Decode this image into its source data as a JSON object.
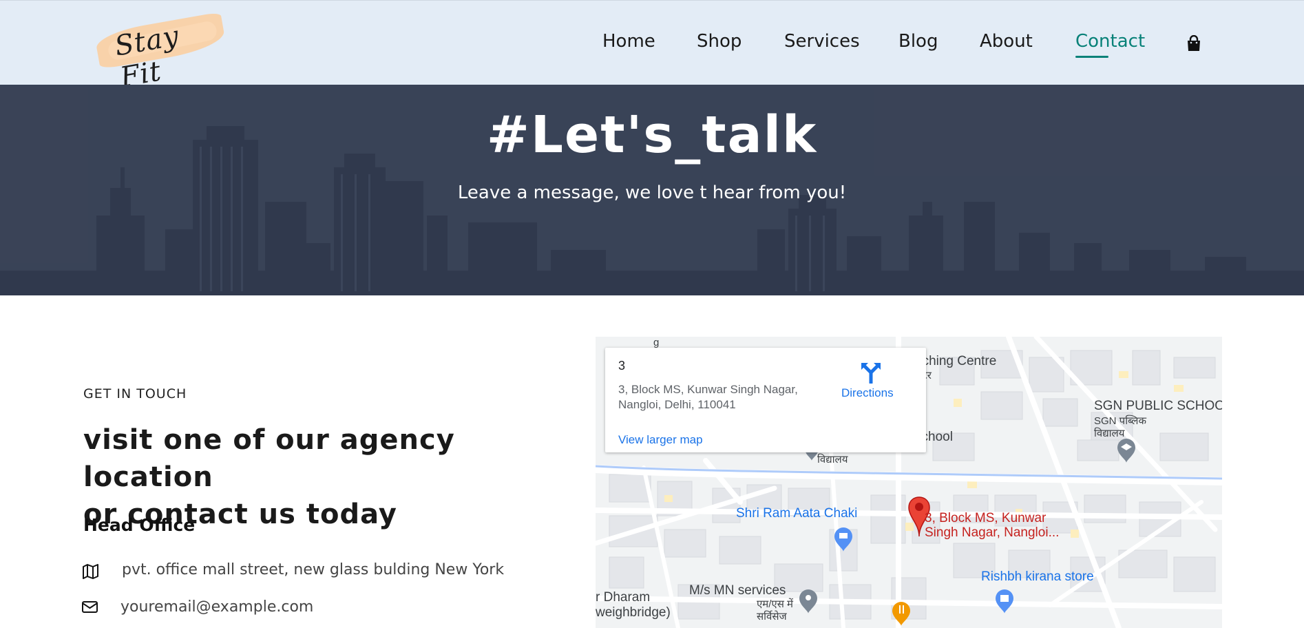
{
  "header": {
    "logo_text": "Stay Fit",
    "nav": [
      {
        "label": "Home"
      },
      {
        "label": "Shop"
      },
      {
        "label": "Services"
      },
      {
        "label": "Blog"
      },
      {
        "label": "About"
      },
      {
        "label": "Contact",
        "active": true
      }
    ],
    "cart_icon": "shopping-bag-icon",
    "accent_color": "#088178"
  },
  "hero": {
    "title": "#Let's_talk",
    "subtitle": "Leave a message, we love t hear from you!"
  },
  "contact": {
    "eyebrow": "GET IN TOUCH",
    "headline_line1": "visit one of our agency location",
    "headline_line2": "or contact us today",
    "office_heading": "Head Office",
    "address": "pvt. office mall street, new glass bulding New York",
    "email": "youremail@example.com",
    "address_icon": "map-icon",
    "email_icon": "envelope-icon"
  },
  "map": {
    "card": {
      "title": "3",
      "address_line1": "3, Block MS, Kunwar Singh Nagar,",
      "address_line2": "Nangloi, Delhi, 110041",
      "directions_label": "Directions",
      "view_larger_label": "View larger map"
    },
    "labels": {
      "coaching": "aching Centre",
      "coaching_hi": "सेंटर",
      "school": "school",
      "school_hi": "विद्यालय",
      "sgn": "SGN PUBLIC SCHOO",
      "sgn_hi1": "SGN पब्लिक",
      "sgn_hi2": "विद्यालय",
      "shri_ram": "Shri Ram Aata Chaki",
      "pin_line1": "3, Block MS, Kunwar",
      "pin_line2": "Singh Nagar, Nangloi...",
      "rishbh": "Rishbh kirana store",
      "mn_services": "M/s MN services",
      "mn_hi1": "एम/एस में",
      "mn_hi2": "सर्विसेज",
      "dharam1": "r Dharam",
      "dharam2": "weighbridge)",
      "top_g": "g"
    }
  }
}
